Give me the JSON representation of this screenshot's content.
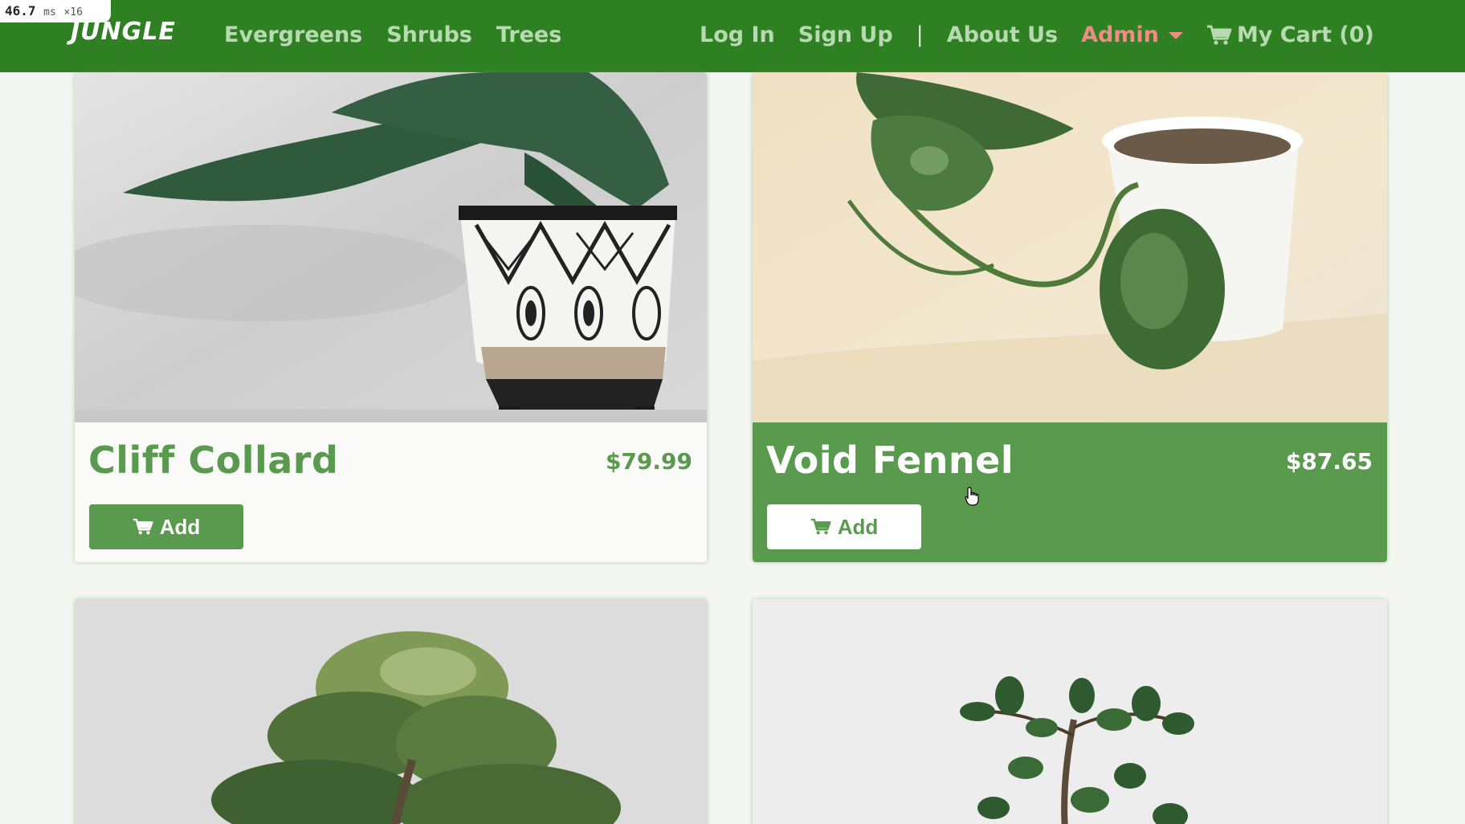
{
  "perf_overlay": {
    "value": "46.7",
    "unit": "ms",
    "multiplier": "×16"
  },
  "navbar": {
    "brand": "JUNGLE",
    "categories": [
      "Evergreens",
      "Shrubs",
      "Trees"
    ],
    "login": "Log In",
    "signup": "Sign Up",
    "divider": "|",
    "about": "About Us",
    "admin": "Admin",
    "cart": "My Cart (0)"
  },
  "products": [
    {
      "name": "Cliff Collard",
      "price": "$79.99",
      "add_label": "Add",
      "hovered": false
    },
    {
      "name": "Void Fennel",
      "price": "$87.65",
      "add_label": "Add",
      "hovered": true
    }
  ],
  "colors": {
    "navbar": "#2e8022",
    "accent_green": "#5a9a4e",
    "admin_pink": "#ef8c86",
    "nav_link": "#b8dab0"
  }
}
